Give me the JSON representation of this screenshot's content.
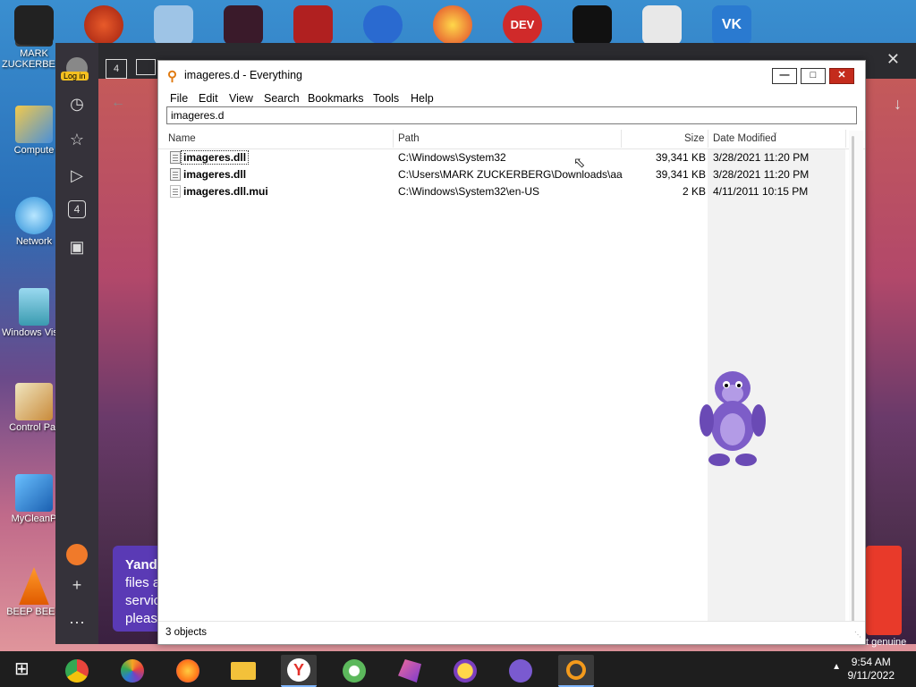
{
  "desktop": {
    "icons": [
      {
        "label": "MARK ZUCKERBERG"
      },
      {
        "label": "Compute"
      },
      {
        "label": "Network"
      },
      {
        "label": "Windows Vista"
      },
      {
        "label": "Control Par"
      },
      {
        "label": "MyCleanP"
      },
      {
        "label": "BEEP BEEP"
      }
    ],
    "top_icons": [
      {
        "name": "star-wars-icon"
      },
      {
        "name": "ccleaner-icon"
      },
      {
        "name": "document-icon"
      },
      {
        "name": "unknown-game-icon"
      },
      {
        "name": "red-box-icon"
      },
      {
        "name": "two-icon"
      },
      {
        "name": "p-icon"
      },
      {
        "name": "dev-cpp-icon",
        "label": "DEV"
      },
      {
        "name": "pirate-icon"
      },
      {
        "name": "papers-icon"
      },
      {
        "name": "vk-icon",
        "label": "VK"
      }
    ]
  },
  "browser": {
    "login_label": "Log in",
    "tab_count": "4",
    "sidebar_counter": "4",
    "toast_title": "Yand",
    "toast_lines": [
      "files a",
      "servic",
      "pleas"
    ],
    "watermark": "t genuine"
  },
  "everything": {
    "title": "imageres.d - Everything",
    "menu": [
      "File",
      "Edit",
      "View",
      "Search",
      "Bookmarks",
      "Tools",
      "Help"
    ],
    "search_value": "imageres.d",
    "columns": {
      "name": "Name",
      "path": "Path",
      "size": "Size",
      "date": "Date Modified"
    },
    "rows": [
      {
        "name": "imageres.dll",
        "path": "C:\\Windows\\System32",
        "size": "39,341 KB",
        "date": "3/28/2021 11:20 PM"
      },
      {
        "name": "imageres.dll",
        "path": "C:\\Users\\MARK ZUCKERBERG\\Downloads\\aa",
        "size": "39,341 KB",
        "date": "3/28/2021 11:20 PM"
      },
      {
        "name": "imageres.dll.mui",
        "path": "C:\\Windows\\System32\\en-US",
        "size": "2 KB",
        "date": "4/11/2011 10:15 PM"
      }
    ],
    "status": "3 objects"
  },
  "taskbar": {
    "apps": [
      {
        "name": "chrome-icon",
        "color": "#e8453c"
      },
      {
        "name": "photos-icon",
        "color": "#f5a623"
      },
      {
        "name": "firefox-icon",
        "color": "#ff7a1a"
      },
      {
        "name": "file-explorer-icon",
        "color": "#f3c13a"
      },
      {
        "name": "yandex-browser-icon",
        "color": "#e4312b"
      },
      {
        "name": "green-app-icon",
        "color": "#5cb85c"
      },
      {
        "name": "gem-app-icon",
        "color": "#d9437a"
      },
      {
        "name": "yahoo-messenger-icon",
        "color": "#7b3fbf"
      },
      {
        "name": "bonzi-buddy-icon",
        "color": "#7a5ad0"
      },
      {
        "name": "everything-search-icon",
        "color": "#f39a1c"
      }
    ],
    "time": "9:54 AM",
    "date": "9/11/2022"
  }
}
